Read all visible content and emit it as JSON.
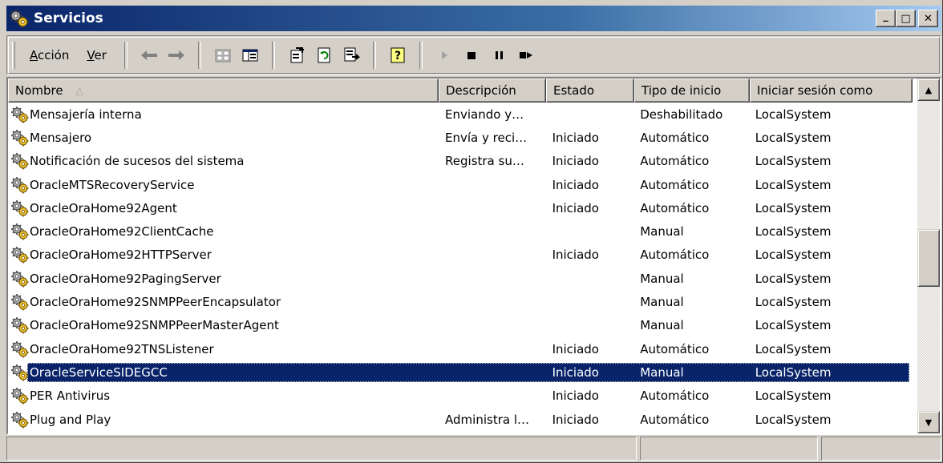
{
  "window": {
    "title": "Servicios",
    "minimize_label": "_",
    "maximize_label": "□",
    "close_label": "✕"
  },
  "menu": {
    "accion_first": "A",
    "accion_rest": "cción",
    "ver_first": "V",
    "ver_rest": "er"
  },
  "columns": {
    "name": "Nombre",
    "description": "Descripción",
    "status": "Estado",
    "startup": "Tipo de inicio",
    "logon": "Iniciar sesión como"
  },
  "services": [
    {
      "name": "Mensajería interna",
      "description": "Enviando y…",
      "status": "",
      "startup": "Deshabilitado",
      "logon": "LocalSystem"
    },
    {
      "name": "Mensajero",
      "description": "Envía y reci…",
      "status": "Iniciado",
      "startup": "Automático",
      "logon": "LocalSystem"
    },
    {
      "name": "Notificación de sucesos del sistema",
      "description": "Registra su…",
      "status": "Iniciado",
      "startup": "Automático",
      "logon": "LocalSystem"
    },
    {
      "name": "OracleMTSRecoveryService",
      "description": "",
      "status": "Iniciado",
      "startup": "Automático",
      "logon": "LocalSystem"
    },
    {
      "name": "OracleOraHome92Agent",
      "description": "",
      "status": "Iniciado",
      "startup": "Automático",
      "logon": "LocalSystem"
    },
    {
      "name": "OracleOraHome92ClientCache",
      "description": "",
      "status": "",
      "startup": "Manual",
      "logon": "LocalSystem"
    },
    {
      "name": "OracleOraHome92HTTPServer",
      "description": "",
      "status": "Iniciado",
      "startup": "Automático",
      "logon": "LocalSystem"
    },
    {
      "name": "OracleOraHome92PagingServer",
      "description": "",
      "status": "",
      "startup": "Manual",
      "logon": "LocalSystem"
    },
    {
      "name": "OracleOraHome92SNMPPeerEncapsulator",
      "description": "",
      "status": "",
      "startup": "Manual",
      "logon": "LocalSystem"
    },
    {
      "name": "OracleOraHome92SNMPPeerMasterAgent",
      "description": "",
      "status": "",
      "startup": "Manual",
      "logon": "LocalSystem"
    },
    {
      "name": "OracleOraHome92TNSListener",
      "description": "",
      "status": "Iniciado",
      "startup": "Automático",
      "logon": "LocalSystem"
    },
    {
      "name": "OracleServiceSIDEGCC",
      "description": "",
      "status": "Iniciado",
      "startup": "Manual",
      "logon": "LocalSystem"
    },
    {
      "name": "PER Antivirus",
      "description": "",
      "status": "Iniciado",
      "startup": "Automático",
      "logon": "LocalSystem"
    },
    {
      "name": "Plug and Play",
      "description": "Administra l…",
      "status": "Iniciado",
      "startup": "Automático",
      "logon": "LocalSystem"
    }
  ],
  "selected_index": 11,
  "icons": {
    "back": "back-arrow-icon",
    "forward": "forward-arrow-icon",
    "play": "play-icon",
    "stop": "stop-icon",
    "pause": "pause-icon",
    "restart": "restart-icon"
  },
  "colors": {
    "title_start": "#0a246a",
    "title_end": "#a6caf0",
    "selection": "#0a246a",
    "face": "#d4d0c8"
  }
}
